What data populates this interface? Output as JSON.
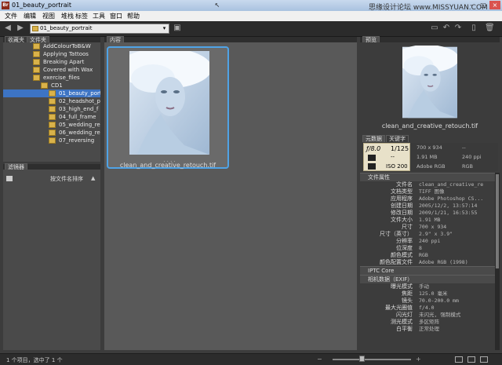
{
  "window": {
    "title": "01_beauty_portrait",
    "app_icon": "Br",
    "watermark": "思缘设计论坛 www.MISSYUAN.COM"
  },
  "menu": [
    "文件",
    "编辑",
    "视图",
    "堆栈",
    "标签",
    "工具",
    "窗口",
    "帮助"
  ],
  "toolbar": {
    "path": "01_beauty_portrait"
  },
  "folders_panel": {
    "tabs": [
      "收藏夹",
      "文件夹"
    ],
    "items": [
      {
        "label": "AddColourToB&W",
        "indent": 0,
        "selected": false
      },
      {
        "label": "Applying Tattoos",
        "indent": 0,
        "selected": false
      },
      {
        "label": "Breaking Apart",
        "indent": 0,
        "selected": false
      },
      {
        "label": "Covered with Wax",
        "indent": 0,
        "selected": false
      },
      {
        "label": "exercise_files",
        "indent": 0,
        "selected": false
      },
      {
        "label": "CD1",
        "indent": 1,
        "selected": false
      },
      {
        "label": "01_beauty_portrait",
        "indent": 2,
        "selected": true
      },
      {
        "label": "02_headshot_p",
        "indent": 2,
        "selected": false
      },
      {
        "label": "03_high_end_f",
        "indent": 2,
        "selected": false
      },
      {
        "label": "04_full_frame",
        "indent": 2,
        "selected": false
      },
      {
        "label": "05_wedding_re",
        "indent": 2,
        "selected": false
      },
      {
        "label": "06_wedding_re",
        "indent": 2,
        "selected": false
      },
      {
        "label": "07_reversing",
        "indent": 2,
        "selected": false
      }
    ]
  },
  "filter_panel": {
    "tab": "滤镜器",
    "sort_label": "按文件名排序"
  },
  "content_panel": {
    "tab": "内容",
    "thumbnail_dots": ". . . .",
    "thumbnail_name": "clean_and_creative_retouch.tif"
  },
  "preview_panel": {
    "tab": "预览",
    "caption": "clean_and_creative_retouch.tif"
  },
  "metadata_panel": {
    "tabs": [
      "元数据",
      "关键字"
    ],
    "exif": {
      "aperture": "ƒ/8.0",
      "shutter": "1/125",
      "iso_label": "ISO 200",
      "dash": "--"
    },
    "summary": [
      [
        "700 x 934",
        "--"
      ],
      [
        "1.91 MB",
        "240 ppi"
      ],
      [
        "Adobe RGB",
        "RGB"
      ]
    ],
    "file_props_header": "文件属性",
    "file_props": [
      [
        "文件名",
        "clean_and_creative_re"
      ],
      [
        "文档类型",
        "TIFF 图像"
      ],
      [
        "应用程序",
        "Adobe Photoshop CS..."
      ],
      [
        "创建日期",
        "2005/12/2, 13:57:14"
      ],
      [
        "修改日期",
        "2009/1/21, 16:53:55"
      ],
      [
        "文件大小",
        "1.91 MB"
      ],
      [
        "尺寸",
        "700 x 934"
      ],
      [
        "尺寸（英寸）",
        "2.9\" x 3.9\""
      ],
      [
        "分辨率",
        "240 ppi"
      ],
      [
        "位深度",
        "8"
      ],
      [
        "颜色模式",
        "RGB"
      ],
      [
        "颜色配置文件",
        "Adobe RGB (1998)"
      ]
    ],
    "iptc_header": "IPTC Core",
    "camera_header": "相机数据（EXIF）",
    "camera": [
      [
        "曝光模式",
        "手动"
      ],
      [
        "焦距",
        "125.0 毫米"
      ],
      [
        "镜头",
        "70.0-200.0 mm"
      ],
      [
        "最大光圈值",
        "f/4.0"
      ],
      [
        "闪光灯",
        "未闪光, 强制模式"
      ],
      [
        "测光模式",
        "多区矩阵"
      ],
      [
        "白平衡",
        "正常处理"
      ]
    ]
  },
  "status": {
    "text": "1 个项目，选中了 1 个"
  },
  "colors": {
    "selection": "#3d74c4",
    "thumb_border": "#4fa3e6",
    "panel_bg": "#4a4a4a"
  }
}
